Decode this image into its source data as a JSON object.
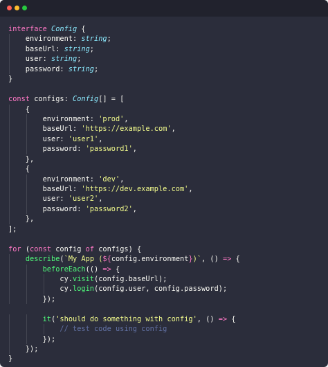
{
  "window": {
    "colors": {
      "close": "#ff5f56",
      "minimize": "#ffbd2e",
      "maximize": "#27c93f"
    }
  },
  "code_lines": [
    [
      {
        "t": "interface ",
        "c": "kw"
      },
      {
        "t": "Config",
        "c": "type"
      },
      {
        "t": " {",
        "c": "punc"
      }
    ],
    [
      {
        "t": "    environment: ",
        "c": "punc"
      },
      {
        "t": "string",
        "c": "type"
      },
      {
        "t": ";",
        "c": "punc"
      }
    ],
    [
      {
        "t": "    baseUrl: ",
        "c": "punc"
      },
      {
        "t": "string",
        "c": "type"
      },
      {
        "t": ";",
        "c": "punc"
      }
    ],
    [
      {
        "t": "    user: ",
        "c": "punc"
      },
      {
        "t": "string",
        "c": "type"
      },
      {
        "t": ";",
        "c": "punc"
      }
    ],
    [
      {
        "t": "    password: ",
        "c": "punc"
      },
      {
        "t": "string",
        "c": "type"
      },
      {
        "t": ";",
        "c": "punc"
      }
    ],
    [
      {
        "t": "}",
        "c": "punc"
      }
    ],
    [],
    [
      {
        "t": "const ",
        "c": "kw"
      },
      {
        "t": "configs: ",
        "c": "punc"
      },
      {
        "t": "Config",
        "c": "type"
      },
      {
        "t": "[] = [",
        "c": "punc"
      }
    ],
    [
      {
        "t": "    {",
        "c": "punc"
      }
    ],
    [
      {
        "t": "        environment: ",
        "c": "punc"
      },
      {
        "t": "'prod'",
        "c": "str"
      },
      {
        "t": ",",
        "c": "punc"
      }
    ],
    [
      {
        "t": "        baseUrl: ",
        "c": "punc"
      },
      {
        "t": "'https://example.com'",
        "c": "str"
      },
      {
        "t": ",",
        "c": "punc"
      }
    ],
    [
      {
        "t": "        user: ",
        "c": "punc"
      },
      {
        "t": "'user1'",
        "c": "str"
      },
      {
        "t": ",",
        "c": "punc"
      }
    ],
    [
      {
        "t": "        password: ",
        "c": "punc"
      },
      {
        "t": "'password1'",
        "c": "str"
      },
      {
        "t": ",",
        "c": "punc"
      }
    ],
    [
      {
        "t": "    },",
        "c": "punc"
      }
    ],
    [
      {
        "t": "    {",
        "c": "punc"
      }
    ],
    [
      {
        "t": "        environment: ",
        "c": "punc"
      },
      {
        "t": "'dev'",
        "c": "str"
      },
      {
        "t": ",",
        "c": "punc"
      }
    ],
    [
      {
        "t": "        baseUrl: ",
        "c": "punc"
      },
      {
        "t": "'https://dev.example.com'",
        "c": "str"
      },
      {
        "t": ",",
        "c": "punc"
      }
    ],
    [
      {
        "t": "        user: ",
        "c": "punc"
      },
      {
        "t": "'user2'",
        "c": "str"
      },
      {
        "t": ",",
        "c": "punc"
      }
    ],
    [
      {
        "t": "        password: ",
        "c": "punc"
      },
      {
        "t": "'password2'",
        "c": "str"
      },
      {
        "t": ",",
        "c": "punc"
      }
    ],
    [
      {
        "t": "    },",
        "c": "punc"
      }
    ],
    [
      {
        "t": "];",
        "c": "punc"
      }
    ],
    [],
    [
      {
        "t": "for ",
        "c": "kw"
      },
      {
        "t": "(",
        "c": "punc"
      },
      {
        "t": "const ",
        "c": "kw"
      },
      {
        "t": "config ",
        "c": "punc"
      },
      {
        "t": "of ",
        "c": "kw"
      },
      {
        "t": "configs) {",
        "c": "punc"
      }
    ],
    [
      {
        "t": "    ",
        "c": "punc"
      },
      {
        "t": "describe",
        "c": "fn"
      },
      {
        "t": "(",
        "c": "punc"
      },
      {
        "t": "`My App (",
        "c": "str"
      },
      {
        "t": "${",
        "c": "kw"
      },
      {
        "t": "config.environment",
        "c": "punc"
      },
      {
        "t": "}",
        "c": "kw"
      },
      {
        "t": ")`",
        "c": "str"
      },
      {
        "t": ", () ",
        "c": "punc"
      },
      {
        "t": "=>",
        "c": "kw"
      },
      {
        "t": " {",
        "c": "punc"
      }
    ],
    [
      {
        "t": "        ",
        "c": "punc"
      },
      {
        "t": "beforeEach",
        "c": "fn"
      },
      {
        "t": "(() ",
        "c": "punc"
      },
      {
        "t": "=>",
        "c": "kw"
      },
      {
        "t": " {",
        "c": "punc"
      }
    ],
    [
      {
        "t": "            cy.",
        "c": "punc"
      },
      {
        "t": "visit",
        "c": "fn"
      },
      {
        "t": "(config.baseUrl);",
        "c": "punc"
      }
    ],
    [
      {
        "t": "            cy.",
        "c": "punc"
      },
      {
        "t": "login",
        "c": "fn"
      },
      {
        "t": "(config.user, config.password);",
        "c": "punc"
      }
    ],
    [
      {
        "t": "        });",
        "c": "punc"
      }
    ],
    [],
    [
      {
        "t": "        ",
        "c": "punc"
      },
      {
        "t": "it",
        "c": "fn"
      },
      {
        "t": "(",
        "c": "punc"
      },
      {
        "t": "'should do something with config'",
        "c": "str"
      },
      {
        "t": ", () ",
        "c": "punc"
      },
      {
        "t": "=>",
        "c": "kw"
      },
      {
        "t": " {",
        "c": "punc"
      }
    ],
    [
      {
        "t": "            // test code using config",
        "c": "comment"
      }
    ],
    [
      {
        "t": "        });",
        "c": "punc"
      }
    ],
    [
      {
        "t": "    });",
        "c": "punc"
      }
    ],
    [
      {
        "t": "}",
        "c": "punc"
      }
    ]
  ]
}
